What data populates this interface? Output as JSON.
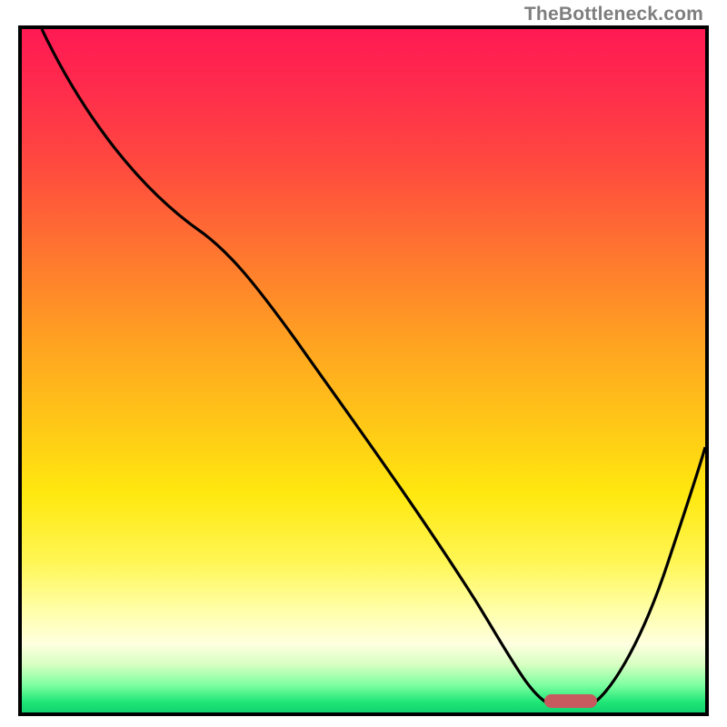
{
  "watermark": {
    "text": "TheBottleneck.com"
  },
  "colors": {
    "frame_border": "#000000",
    "marker_fill": "#c65a5f",
    "curve_stroke": "#000000",
    "gradient_stops": [
      "#ff1a53",
      "#ff2a4d",
      "#ff4a3f",
      "#ff7a2e",
      "#ffa321",
      "#ffc817",
      "#ffe80f",
      "#fff655",
      "#ffffa8",
      "#ffffe0",
      "#d7ffc2",
      "#7dffa0",
      "#1fe676",
      "#11d36e"
    ]
  },
  "chart_data": {
    "type": "line",
    "title": "",
    "xlabel": "",
    "ylabel": "",
    "xlim": [
      0,
      100
    ],
    "ylim": [
      0,
      100
    ],
    "grid": false,
    "legend": false,
    "x": [
      3,
      10,
      20,
      27,
      35,
      45,
      55,
      65,
      72,
      75,
      80,
      83,
      88,
      94,
      100
    ],
    "values": [
      100,
      90,
      78,
      70,
      60,
      48,
      36,
      24,
      12,
      4,
      1,
      0.5,
      3,
      15,
      30
    ],
    "marker": {
      "x_range": [
        76,
        84
      ],
      "y": 0.5
    },
    "background": "vertical red→yellow→green gradient (heatmap semantics: top=bad/red, bottom=good/green)"
  }
}
